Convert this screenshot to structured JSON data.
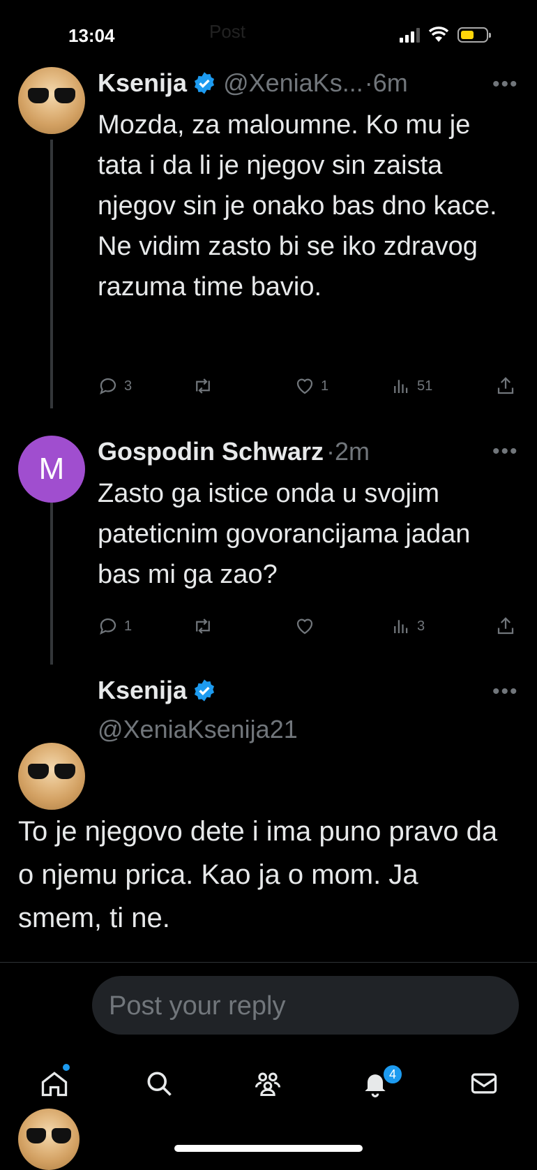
{
  "status_bar": {
    "time": "13:04",
    "battery_color": "#ffd60a",
    "top_hint": "Post"
  },
  "tweets": [
    {
      "name": "Ksenija",
      "verified": true,
      "handle": "@XeniaKs...",
      "time": "·6m",
      "text": "Mozda, za maloumne. Ko mu je tata i da li je njegov sin zaista njegov sin je onako bas dno kace. Ne vidim zasto bi se iko zdravog razuma time bavio.",
      "replies": "3",
      "retweets": "",
      "likes": "1",
      "views": "51"
    },
    {
      "name": "Gospodin Schwarz",
      "avatar_letter": "M",
      "avatar_color": "#a04ecf",
      "time": "·2m",
      "text": "Zasto ga istice onda u svojim pateticnim govorancijama jadan bas mi ga zao?",
      "replies": "1",
      "retweets": "",
      "likes": "",
      "views": "3"
    }
  ],
  "main_tweet": {
    "name": "Ksenija",
    "verified": true,
    "handle": "@XeniaKsenija21",
    "text": "To je njegovo dete i ima puno pravo da o njemu prica. Kao ja o mom. Ja smem, ti ne."
  },
  "reply_box": {
    "placeholder": "Post your reply"
  },
  "bottom_nav": {
    "notifications_badge": "4",
    "accent_color": "#1d9bf0"
  },
  "icons": {
    "more": "more-horizontal-icon",
    "verified": "verified-badge-icon",
    "reply": "reply-icon",
    "retweet": "retweet-icon",
    "like": "heart-icon",
    "views": "views-icon",
    "share": "share-icon",
    "home": "home-icon",
    "search": "search-icon",
    "communities": "communities-icon",
    "notifications": "bell-icon",
    "messages": "mail-icon"
  }
}
